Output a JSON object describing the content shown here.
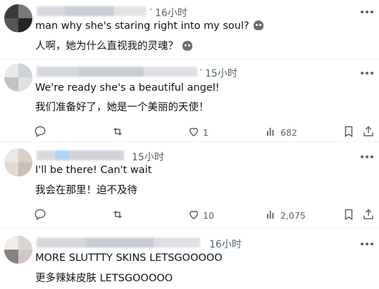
{
  "replies": [
    {
      "time": "16小时",
      "lines": [
        "man why she's staring right into my soul?",
        "人啊，她为什么直视我的灵魂？"
      ],
      "emoji": "skull-icon"
    },
    {
      "time": "15小时",
      "lines": [
        "We're ready she's a beautiful angel!",
        "我们准备好了，她是一个美丽的天使！"
      ],
      "likes": "1",
      "views": "682"
    },
    {
      "time": "15小时",
      "lines": [
        "I'll be there! Can't wait",
        "我会在那里！迫不及待"
      ],
      "likes": "10",
      "views": "2,075"
    },
    {
      "time": "16小时",
      "lines": [
        "MORE SLUTTTY SKINS LETSGOOOOO",
        "更多辣妹皮肤 LETSGOOOOO"
      ]
    }
  ],
  "colors": {
    "text": "#0f1419",
    "muted": "#536471",
    "divider": "#eff3f4",
    "blur": "#d3d7dc"
  }
}
